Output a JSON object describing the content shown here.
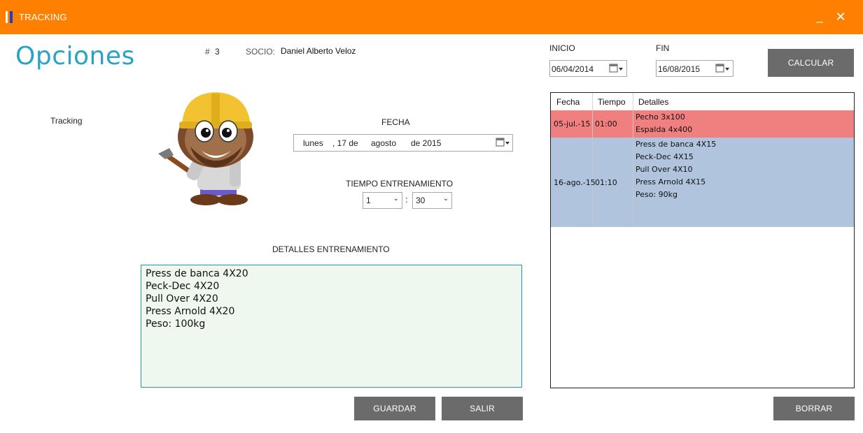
{
  "window": {
    "title": "TRACKING",
    "minimize_label": "_",
    "close_label": "✕"
  },
  "header": {
    "title": "Opciones",
    "num_hash": "#",
    "num_value": "3",
    "socio_label": "SOCIO:",
    "socio_name": "Daniel Alberto Veloz"
  },
  "sidebar": {
    "tracking_label": "Tracking"
  },
  "form": {
    "fecha_label": "FECHA",
    "fecha": {
      "weekday": "lunes",
      "day": ", 17 de",
      "month": "agosto",
      "year": "de 2015"
    },
    "tiempo_label": "TIEMPO ENTRENAMIENTO",
    "hours_value": "1",
    "minutes_value": "30",
    "time_separator": ":",
    "detalles_label": "DETALLES ENTRENAMIENTO",
    "detalles_lines": [
      "Press de banca 4X20",
      "Peck-Dec 4X20",
      "Pull Over 4X20",
      "Press Arnold 4X20",
      "Peso: 100kg"
    ],
    "guardar_label": "GUARDAR",
    "salir_label": "SALIR"
  },
  "range": {
    "inicio_label": "INICIO",
    "inicio_value": "06/04/2014",
    "fin_label": "FIN",
    "fin_value": "16/08/2015",
    "calcular_label": "CALCULAR"
  },
  "grid": {
    "columns": [
      "Fecha",
      "Tiempo",
      "Detalles"
    ],
    "rows": [
      {
        "fecha": "05-jul.-15",
        "tiempo": "01:00",
        "detalles": [
          "Pecho 3x100",
          "Espalda 4x400"
        ]
      },
      {
        "fecha": "16-ago.-15",
        "tiempo": "01:10",
        "detalles": [
          "Press de banca 4X15",
          "Peck-Dec 4X15",
          "Pull Over 4X10",
          "Press Arnold 4X15",
          "Peso: 90kg"
        ]
      }
    ],
    "borrar_label": "BORRAR"
  },
  "colors": {
    "titlebar": "#ff8000",
    "heading": "#2aa3c7",
    "button": "#6b6b6b",
    "row_highlight": "#f08080",
    "row_selected": "#b0c4de",
    "detalles_bg": "#eef8ee"
  },
  "icons": {
    "app": "app-logo-icon",
    "calendar": "calendar-dropdown-icon",
    "mascot": "builder-mascot-icon"
  }
}
